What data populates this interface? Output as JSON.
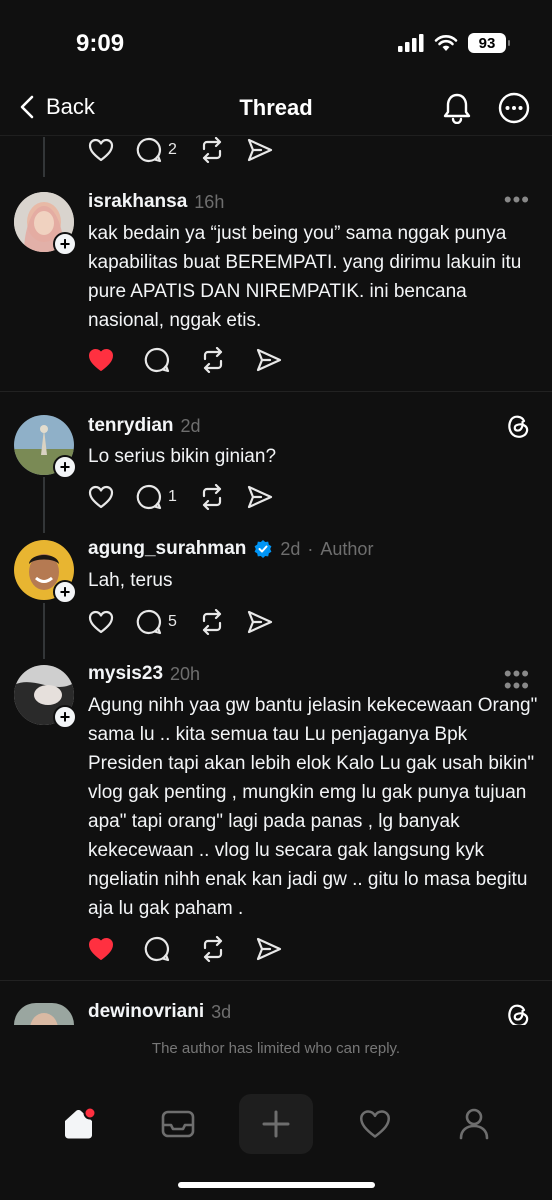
{
  "status": {
    "time": "9:09",
    "battery": "93"
  },
  "nav": {
    "back_label": "Back",
    "title": "Thread"
  },
  "top_actions": {
    "reply_count": "2"
  },
  "posts": [
    {
      "username": "israkhansa",
      "time": "16h",
      "text": "kak bedain ya “just being you” sama nggak punya kapabilitas buat BEREMPATI. yang dirimu lakuin itu pure APATIS DAN NIREMPATIK. ini bencana nasional, nggak etis.",
      "liked": true
    },
    {
      "username": "tenrydian",
      "time": "2d",
      "text": "Lo serius bikin ginian?",
      "reply_count": "1"
    },
    {
      "username": "agung_surahman",
      "time": "2d",
      "author_label": "Author",
      "text": "Lah, terus",
      "reply_count": "5"
    },
    {
      "username": "mysis23",
      "time": "20h",
      "text": "Agung nihh yaa gw bantu jelasin kekecewaan Orang\" sama lu .. kita semua tau Lu penjaganya Bpk Presiden tapi akan lebih elok Kalo Lu gak usah bikin\" vlog gak penting , mungkin emg lu gak punya tujuan apa\" tapi orang\" lagi pada panas , lg banyak kekecewaan .. vlog lu secara gak langsung kyk ngeliatin nihh enak kan jadi gw .. gitu lo masa begitu aja lu gak paham .",
      "liked": true
    },
    {
      "username": "dewinovriani",
      "time": "3d"
    }
  ],
  "reply_limit_text": "The author has limited who can reply.",
  "colors": {
    "background": "#101010",
    "like_red": "#ff3040",
    "verified_blue": "#0095f6",
    "muted": "#6e6e6e"
  }
}
